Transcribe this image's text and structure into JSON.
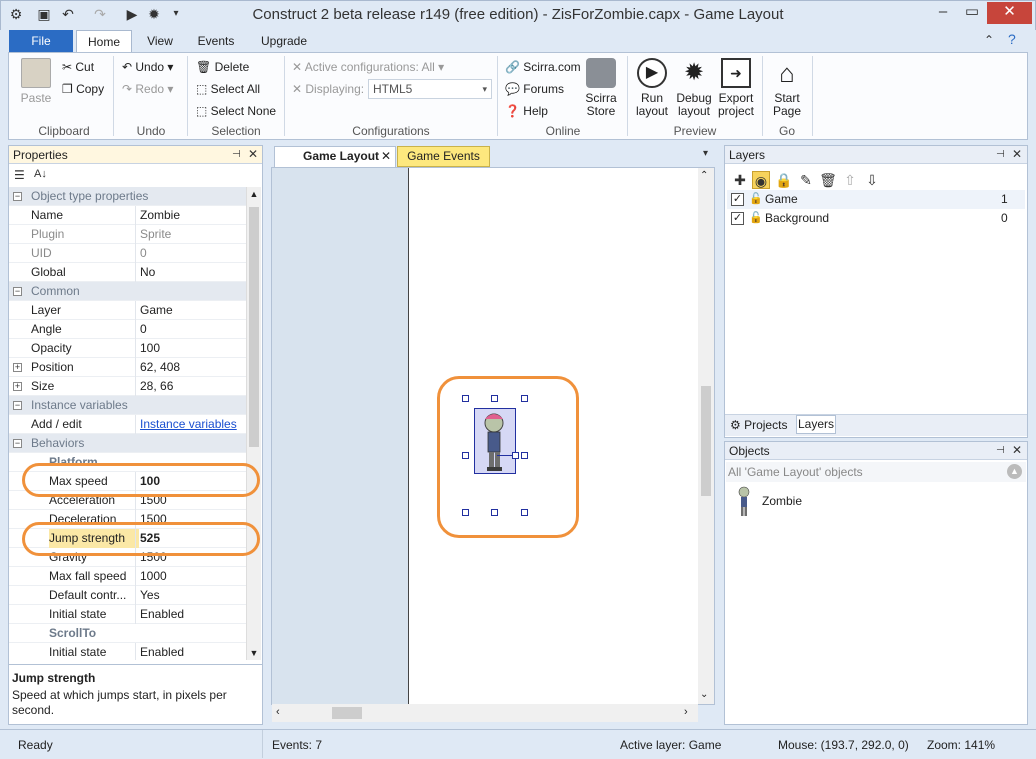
{
  "window": {
    "title": "Construct 2 beta release r149  (free edition) - ZisForZombie.capx - Game Layout"
  },
  "menu_tabs": [
    "File",
    "Home",
    "View",
    "Events",
    "Upgrade"
  ],
  "ribbon": {
    "clipboard": {
      "paste": "Paste",
      "cut": "Cut",
      "copy": "Copy",
      "label": "Clipboard"
    },
    "undo": {
      "undo": "Undo",
      "redo": "Redo",
      "label": "Undo"
    },
    "selection": {
      "delete": "Delete",
      "select_all": "Select All",
      "select_none": "Select None",
      "label": "Selection"
    },
    "configurations": {
      "active": "Active configurations: All",
      "displaying_label": "Displaying:",
      "displaying_value": "HTML5",
      "label": "Configurations"
    },
    "online": {
      "scirra": "Scirra.com",
      "forums": "Forums",
      "help": "Help",
      "store": [
        "Scirra",
        "Store"
      ],
      "label": "Online"
    },
    "preview": {
      "run": [
        "Run",
        "layout"
      ],
      "debug": [
        "Debug",
        "layout"
      ],
      "export": [
        "Export",
        "project"
      ],
      "label": "Preview"
    },
    "go": {
      "start": [
        "Start",
        "Page"
      ],
      "label": "Go"
    }
  },
  "properties": {
    "header": "Properties",
    "rows": [
      {
        "type": "cat",
        "name": "Object type properties"
      },
      {
        "name": "Name",
        "value": "Zombie"
      },
      {
        "name": "Plugin",
        "value": "Sprite",
        "gray": true
      },
      {
        "name": "UID",
        "value": "0",
        "gray": true
      },
      {
        "name": "Global",
        "value": "No"
      },
      {
        "type": "cat",
        "name": "Common"
      },
      {
        "name": "Layer",
        "value": "Game"
      },
      {
        "name": "Angle",
        "value": "0"
      },
      {
        "name": "Opacity",
        "value": "100"
      },
      {
        "name": "Position",
        "value": "62, 408",
        "expand": true
      },
      {
        "name": "Size",
        "value": "28, 66",
        "expand": true
      },
      {
        "type": "cat",
        "name": "Instance variables"
      },
      {
        "name": "Add / edit",
        "value": "Instance variables",
        "link": true
      },
      {
        "type": "cat",
        "name": "Behaviors"
      },
      {
        "type": "subcat",
        "name": "Platform"
      },
      {
        "name": "Max speed",
        "value": "100",
        "indent": true,
        "bold": true
      },
      {
        "name": "Acceleration",
        "value": "1500",
        "indent": true
      },
      {
        "name": "Deceleration",
        "value": "1500",
        "indent": true
      },
      {
        "name": "Jump strength",
        "value": "525",
        "indent": true,
        "bold": true,
        "selected": true
      },
      {
        "name": "Gravity",
        "value": "1500",
        "indent": true
      },
      {
        "name": "Max fall speed",
        "value": "1000",
        "indent": true
      },
      {
        "name": "Default contr...",
        "value": "Yes",
        "indent": true
      },
      {
        "name": "Initial state",
        "value": "Enabled",
        "indent": true
      },
      {
        "type": "subcat",
        "name": "ScrollTo"
      },
      {
        "name": "Initial state",
        "value": "Enabled",
        "indent": true
      }
    ],
    "help_title": "Jump strength",
    "help_text": "Speed at which jumps start, in pixels per second."
  },
  "doc_tabs": [
    {
      "label": "Game Layout",
      "active": true
    },
    {
      "label": "Game Events",
      "active": false
    }
  ],
  "layers": {
    "header": "Layers",
    "items": [
      {
        "name": "Game",
        "index": "1"
      },
      {
        "name": "Background",
        "index": "0"
      }
    ],
    "bottom_tabs": [
      "Projects",
      "Layers"
    ]
  },
  "objects": {
    "header": "Objects",
    "filter": "All 'Game Layout' objects",
    "items": [
      {
        "name": "Zombie"
      }
    ]
  },
  "status": {
    "ready": "Ready",
    "events": "Events: 7",
    "active_layer": "Active layer: Game",
    "mouse": "Mouse: (193.7, 292.0, 0)",
    "zoom": "Zoom: 141%"
  },
  "colors": {
    "accent": "#2b6cc4",
    "highlight": "#f0913b",
    "close": "#c7453b"
  }
}
